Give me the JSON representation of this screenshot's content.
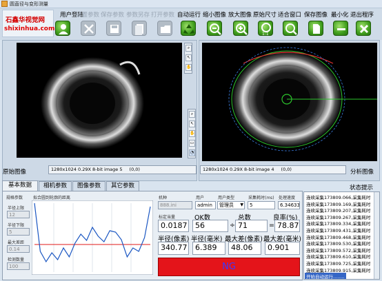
{
  "window": {
    "title": "圆直径与变形测量"
  },
  "logo": {
    "line1": "石鑫华视觉网",
    "line2": "shixinhua.com"
  },
  "menu": [
    {
      "label": "用户登陆",
      "enabled": true
    },
    {
      "label": "设置参数",
      "enabled": false
    },
    {
      "label": "保存参数",
      "enabled": false
    },
    {
      "label": "参数另存",
      "enabled": false
    },
    {
      "label": "打开参数",
      "enabled": false
    },
    {
      "label": "自动运行",
      "enabled": true
    },
    {
      "label": "缩小图像",
      "enabled": true
    },
    {
      "label": "放大图像",
      "enabled": true
    },
    {
      "label": "原始尺寸",
      "enabled": true
    },
    {
      "label": "适合窗口",
      "enabled": true
    },
    {
      "label": "保存图像",
      "enabled": true
    },
    {
      "label": "最小化",
      "enabled": true
    },
    {
      "label": "退出程序",
      "enabled": true
    }
  ],
  "toolbar_icons": [
    "user-icon",
    "tools-icon",
    "save-icon",
    "save-as-icon",
    "open-folder-icon",
    "recycle-icon",
    "zoom-out-icon",
    "zoom-in-icon",
    "zoom-1to1-icon",
    "zoom-fit-icon",
    "document-icon",
    "minimize-icon",
    "close-icon"
  ],
  "tool_icons": [
    "zoom-tool",
    "pointer-tool",
    "pan-tool"
  ],
  "images": {
    "original": {
      "label": "原始图像",
      "info": "1280x1024 0.29X 8-bit image 5",
      "coords": "(0,0)"
    },
    "analysis": {
      "label": "分析图像",
      "info": "1280x1024 0.29X 8-bit image 4",
      "coords": "(0,0)"
    }
  },
  "tabs": [
    {
      "label": "基本数据",
      "active": true
    },
    {
      "label": "相机参数",
      "active": false
    },
    {
      "label": "图像参数",
      "active": false
    },
    {
      "label": "其它参数",
      "active": false
    }
  ],
  "params": {
    "group_label": "规格参数",
    "items": [
      {
        "label": "半径上限",
        "value": "12"
      },
      {
        "label": "半径下限",
        "value": "5"
      },
      {
        "label": "最大差距",
        "value": "0.14"
      },
      {
        "label": "检测数量",
        "value": "100"
      }
    ]
  },
  "chart_data": {
    "type": "line",
    "title": "拟合圆到轮廓的距离",
    "xlabel": "",
    "ylabel": "",
    "threshold": 0.4,
    "x": [
      0,
      5,
      10,
      15,
      20,
      25,
      30,
      35,
      40,
      45,
      50,
      55,
      60,
      65,
      70,
      75,
      80,
      85,
      90,
      95,
      100
    ],
    "values": [
      1.0,
      0.3,
      0.15,
      0.28,
      0.18,
      0.35,
      0.22,
      0.42,
      0.55,
      0.46,
      0.65,
      0.52,
      0.44,
      0.6,
      0.58,
      0.47,
      0.22,
      0.35,
      0.3,
      0.5,
      0.95
    ],
    "colors": {
      "line": "#1a56c2",
      "threshold": "#e01818"
    }
  },
  "machine": {
    "label": "机种",
    "value": "888.ini",
    "user_label": "用户",
    "user_value": "admin",
    "type_label": "用户类型",
    "type_value": "管理员",
    "time_label": "采集耗时(ms)",
    "time_value": "5",
    "speed_label": "处理速度",
    "speed_value": "6.34633"
  },
  "stats": {
    "calib_label": "标定当量",
    "calib_value": "0.0187",
    "ok_label": "OK数",
    "ok_value": "56",
    "total_label": "总数",
    "total_value": "71",
    "divide": "÷",
    "equals": "=",
    "rate_label": "良率(%)",
    "rate_value": "78.87",
    "rpx_label": "半径(像素)",
    "rpx_value": "340.77",
    "rmm_label": "半径(毫米)",
    "rmm_value": "6.389",
    "dpx_label": "最大差(像素)",
    "dpx_value": "48.06",
    "dmm_label": "最大差(毫米)",
    "dmm_value": "0.901"
  },
  "result": {
    "text": "NG",
    "color": "#e4141a"
  },
  "status": {
    "title": "状态提示",
    "log": [
      "连续采集173809.066,采集耗时",
      "连续采集173809.169,采集耗时",
      "连续采集173809.207,采集耗时",
      "连续采集173809.267,采集耗时",
      "连续采集173809.334,采集耗时",
      "连续采集173809.431,采集耗时",
      "连续采集173809.468,采集耗时",
      "连续采集173809.530,采集耗时",
      "连续采集173809.572,采集耗时",
      "连续采集173809.610,采集耗时",
      "连续采集173809.725,采集耗时",
      "连续采集173809.915,采集耗时"
    ],
    "current": "开始自动运行........"
  }
}
